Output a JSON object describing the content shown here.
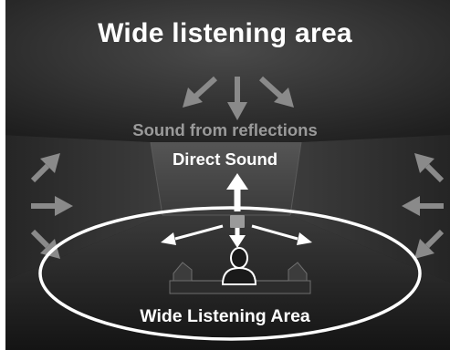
{
  "title": "Wide listening area",
  "labels": {
    "reflections": "Sound from reflections",
    "direct": "Direct Sound",
    "listening_area": "Wide Listening Area"
  },
  "colors": {
    "background_dark": "#1a1a1a",
    "ceiling": "#3a3a3a",
    "reflection_arrows": "#8a8a8a",
    "direct_arrows": "#ffffff",
    "ellipse": "#ffffff"
  }
}
